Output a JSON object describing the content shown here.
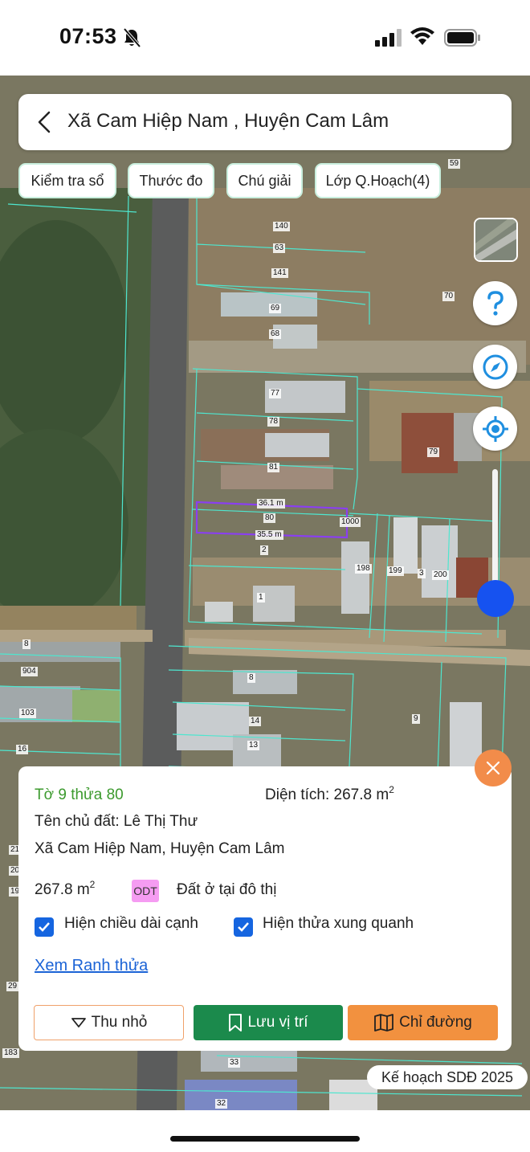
{
  "status_bar": {
    "time": "07:53"
  },
  "header": {
    "title": "Xã Cam Hiệp Nam , Huyện Cam Lâm"
  },
  "toolbar": {
    "check_book": "Kiểm tra sổ",
    "ruler": "Thước đo",
    "legend": "Chú giải",
    "planning_layer": "Lớp Q.Hoạch(4)"
  },
  "map": {
    "parcel_labels": [
      "59",
      "140",
      "63",
      "141",
      "70",
      "69",
      "68",
      "77",
      "78",
      "79",
      "81",
      "36.1 m",
      "80",
      "1000",
      "35.5 m",
      "2",
      "198",
      "199",
      "3",
      "200",
      "1",
      "8",
      "904",
      "103",
      "16",
      "8",
      "14",
      "13",
      "9",
      "33",
      "32",
      "183",
      "29",
      "21",
      "20",
      "19"
    ],
    "selected_parcel_color": "#8a3ff0",
    "boundary_color": "#4ee6cf"
  },
  "panel": {
    "sheet_parcel": "Tờ 9 thửa 80",
    "area_label": "Diện tích: 267.8 m",
    "area_sup": "2",
    "owner": "Tên chủ đất: Lê Thị Thư",
    "address": "Xã Cam Hiệp Nam, Huyện Cam Lâm",
    "area_value": "267.8 m",
    "area_value_sup": "2",
    "land_code": "ODT",
    "land_type": "Đất ở tại đô thị",
    "show_edge_length": "Hiện chiều dài cạnh",
    "show_edge_length_checked": true,
    "show_neighbors": "Hiện thửa xung quanh",
    "show_neighbors_checked": true,
    "view_boundary_link": "Xem Ranh thửa",
    "collapse_button": "Thu nhỏ",
    "save_button": "Lưu vị trí",
    "directions_button": "Chỉ đường"
  },
  "plan_badge": "Kế hoạch SDĐ 2025",
  "colors": {
    "accent_orange": "#f2913f",
    "save_green": "#1b8a4c",
    "link_blue": "#1b63d6",
    "checkbox_blue": "#1565e0",
    "odt_pink": "#f59cf2",
    "zoom_knob": "#1652f0"
  }
}
